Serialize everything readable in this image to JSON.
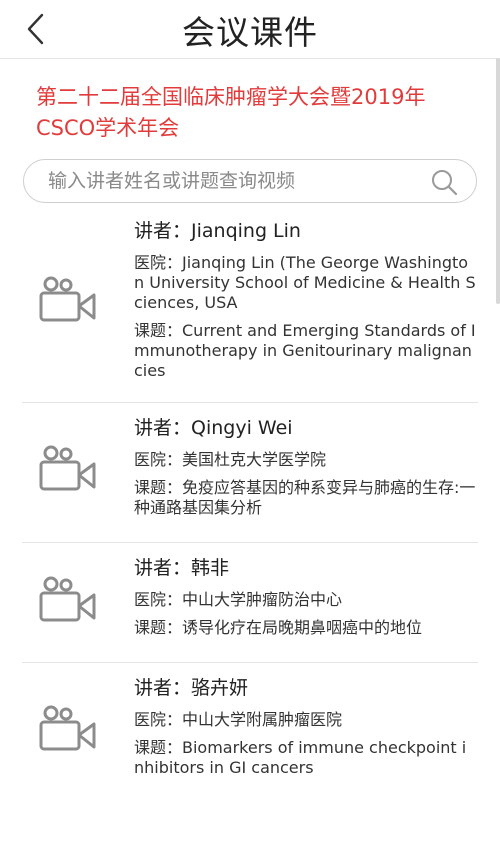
{
  "header": {
    "title": "会议课件",
    "back_icon": "chevron-left-icon"
  },
  "conference": {
    "title": "第二十二届全国临床肿瘤学大会暨2019年CSCO学术年会",
    "title_color": "#e23b3b"
  },
  "search": {
    "placeholder": "输入讲者姓名或讲题查询视频",
    "value": "",
    "icon": "search-icon"
  },
  "videos": [
    {
      "speaker": "讲者：Jianqing Lin",
      "hospital": "医院：Jianqing Lin (The George Washington University School of Medicine & Health Sciences, USA",
      "topic": "课题：Current and Emerging Standards of Immunotherapy in Genitourinary malignancies",
      "icon": "video-camera-icon"
    },
    {
      "speaker": "讲者：Qingyi Wei",
      "hospital": "医院：美国杜克大学医学院",
      "topic": "课题：免疫应答基因的种系变异与肺癌的生存:一种通路基因集分析",
      "icon": "video-camera-icon"
    },
    {
      "speaker": "讲者：韩非",
      "hospital": "医院：中山大学肿瘤防治中心",
      "topic": "课题：诱导化疗在局晚期鼻咽癌中的地位",
      "icon": "video-camera-icon"
    },
    {
      "speaker": "讲者：骆卉妍",
      "hospital": "医院：中山大学附属肿瘤医院",
      "topic": "课题：Biomarkers of immune checkpoint inhibitors in GI cancers",
      "icon": "video-camera-icon"
    }
  ]
}
